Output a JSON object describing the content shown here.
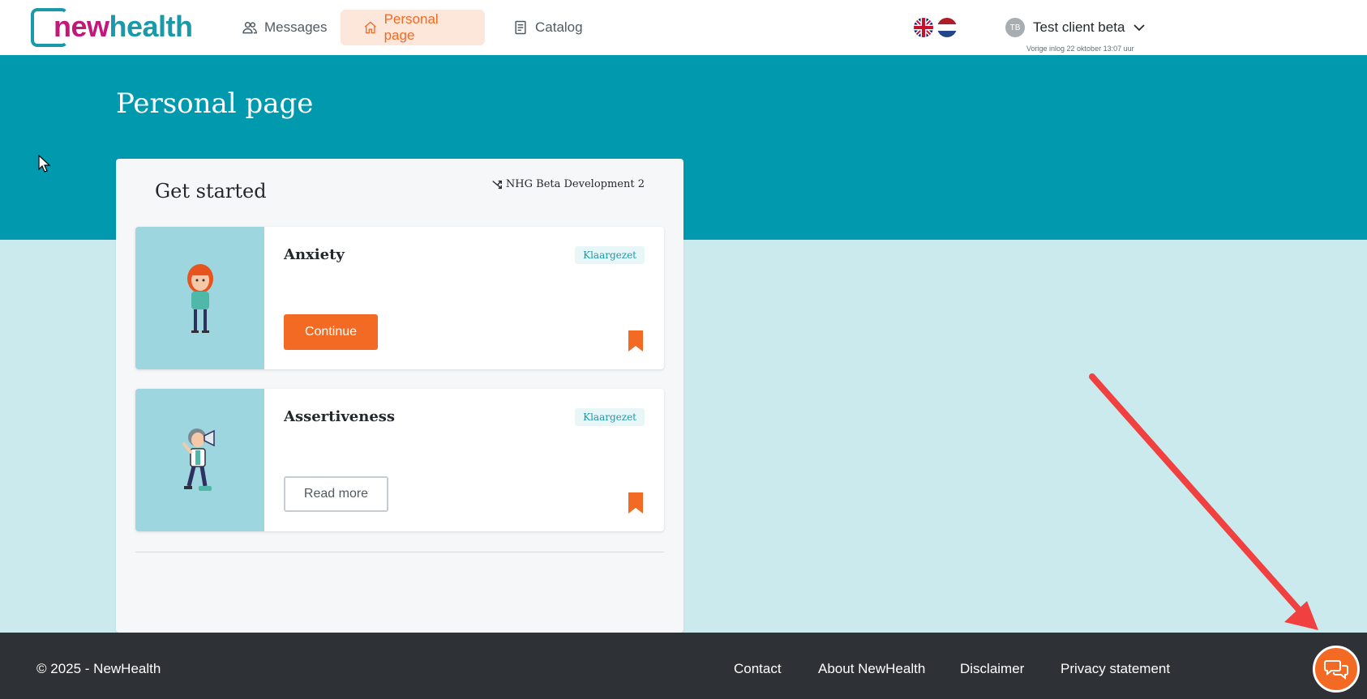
{
  "header": {
    "logo": {
      "part1": "new",
      "part2": "health"
    },
    "nav": [
      {
        "label": "Messages",
        "icon": "users-icon"
      },
      {
        "label": "Personal page",
        "icon": "home-icon",
        "active": true
      },
      {
        "label": "Catalog",
        "icon": "book-icon"
      }
    ],
    "languages": [
      "English",
      "Nederlands"
    ],
    "user": {
      "initials": "TB",
      "name": "Test client beta",
      "last_login": "Vorige inlog 22 oktober 13:07 uur"
    }
  },
  "page": {
    "title": "Personal page"
  },
  "panel": {
    "title": "Get started",
    "organization": "NHG Beta Development 2",
    "cards": [
      {
        "title": "Anxiety",
        "status": "Klaargezet",
        "button": "Continue"
      },
      {
        "title": "Assertiveness",
        "status": "Klaargezet",
        "button": "Read more"
      }
    ]
  },
  "footer": {
    "copyright": "© 2025 - NewHealth",
    "links": [
      "Contact",
      "About NewHealth",
      "Disclaimer",
      "Privacy statement"
    ]
  },
  "colors": {
    "accent": "#f26a24",
    "teal": "#0099ae",
    "light_teal": "#cbeaed",
    "footer": "#2e3136",
    "logo_magenta": "#c2187a"
  }
}
